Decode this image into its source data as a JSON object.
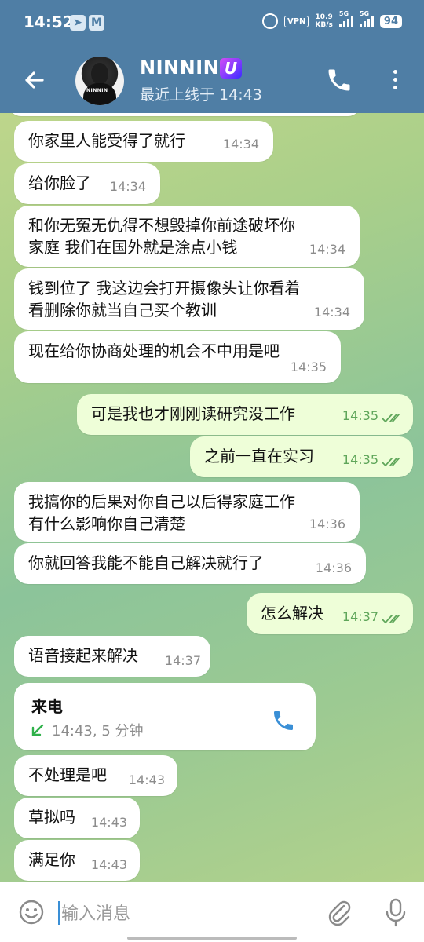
{
  "statusbar": {
    "time": "14:52",
    "vpn": "VPN",
    "speed_value": "10.9",
    "speed_unit": "KB/s",
    "net1": "5G",
    "net2": "5G",
    "battery": "94"
  },
  "header": {
    "name": "NINNIN",
    "badge": "U",
    "status": "最近上线于 14:43",
    "avatar_text": "NINNIN"
  },
  "messages": [
    {
      "dir": "in",
      "text": "你家里人能受得了就行",
      "time": "14:34"
    },
    {
      "dir": "in",
      "text": "给你脸了",
      "time": "14:34"
    },
    {
      "dir": "in",
      "lines": [
        "和你无冤无仇得不想毁掉你前途破坏你",
        "家庭 我们在国外就是涂点小钱"
      ],
      "time": "14:34"
    },
    {
      "dir": "in",
      "lines": [
        "钱到位了 我这边会打开摄像头让你看着",
        "看删除你就当自己买个教训"
      ],
      "time": "14:34"
    },
    {
      "dir": "in",
      "text": "现在给你协商处理的机会不中用是吧",
      "time": "14:35"
    },
    {
      "dir": "out",
      "text": "可是我也才刚刚读研究没工作",
      "time": "14:35"
    },
    {
      "dir": "out",
      "text": "之前一直在实习",
      "time": "14:35"
    },
    {
      "dir": "in",
      "lines": [
        "我搞你的后果对你自己以后得家庭工作",
        "有什么影响你自己清楚"
      ],
      "time": "14:36"
    },
    {
      "dir": "in",
      "text": "你就回答我能不能自己解决就行了",
      "time": "14:36"
    },
    {
      "dir": "out",
      "text": "怎么解决",
      "time": "14:37"
    },
    {
      "dir": "in",
      "text": "语音接起来解决",
      "time": "14:37"
    },
    {
      "dir": "in",
      "text": "不处理是吧",
      "time": "14:43"
    },
    {
      "dir": "in",
      "text": "草拟吗",
      "time": "14:43"
    },
    {
      "dir": "in",
      "text": "满足你",
      "time": "14:43"
    }
  ],
  "call": {
    "title": "来电",
    "meta": "14:43, 5 分钟"
  },
  "input": {
    "placeholder": "输入消息"
  },
  "colors": {
    "header": "#4f7ea5",
    "outgoing_bubble": "#eefed8",
    "incoming_bubble": "#ffffff",
    "accent": "#3a8fd6",
    "check": "#5fa65a"
  }
}
